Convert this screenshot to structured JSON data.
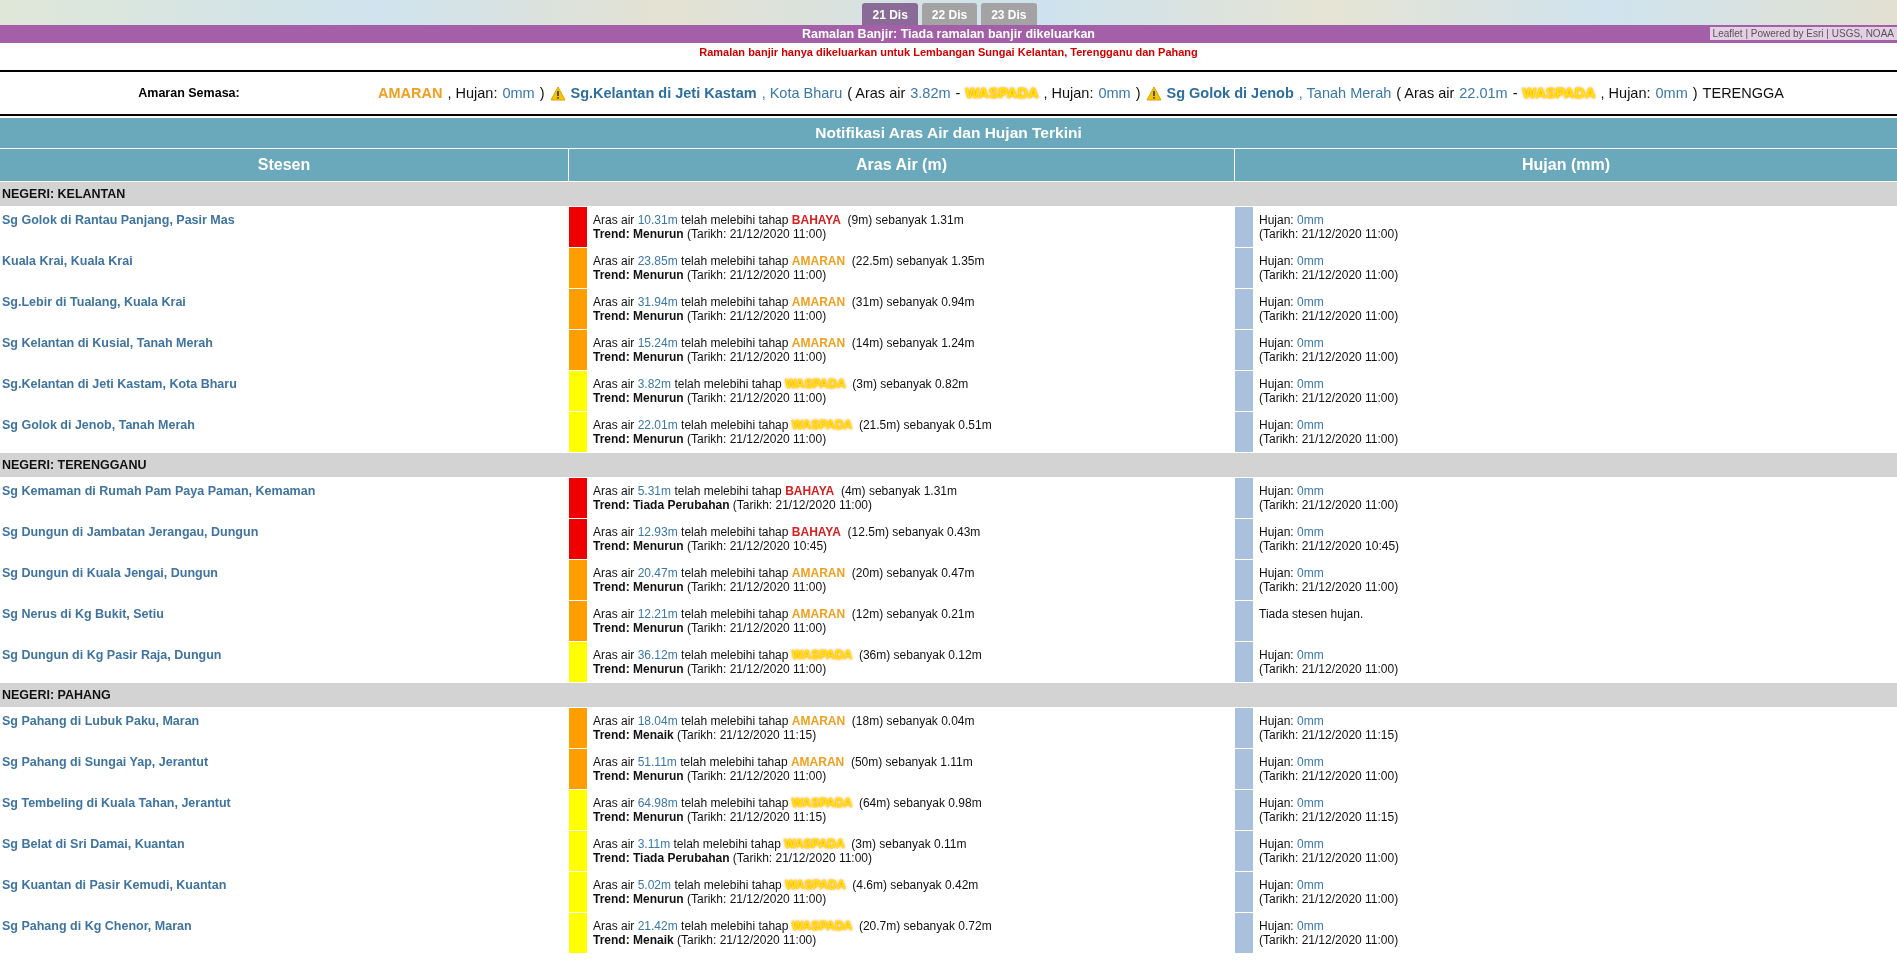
{
  "map": {
    "tabs": [
      {
        "label": "21 Dis",
        "selected": true
      },
      {
        "label": "22 Dis",
        "selected": false
      },
      {
        "label": "23 Dis",
        "selected": false
      }
    ],
    "attribution": "Leaflet | Powered by Esri | USGS, NOAA"
  },
  "forecast": {
    "title": "Ramalan Banjir: Tiada ramalan banjir dikeluarkan",
    "note": "Ramalan banjir hanya dikeluarkan untuk Lembangan Sungai Kelantan, Terengganu dan Pahang"
  },
  "current_alerts": {
    "label": "Amaran Semasa:",
    "ticker": [
      {
        "kind": "status",
        "text": "AMARAN",
        "color": "#f0a020"
      },
      {
        "kind": "plain",
        "text": ", Hujan:"
      },
      {
        "kind": "value",
        "text": "0mm"
      },
      {
        "kind": "plain",
        "text": ")"
      },
      {
        "kind": "icon"
      },
      {
        "kind": "station",
        "text": "Sg.Kelantan di Jeti Kastam"
      },
      {
        "kind": "place",
        "text": ", Kota Bharu"
      },
      {
        "kind": "plain",
        "text": "( Aras air"
      },
      {
        "kind": "value",
        "text": "3.82m"
      },
      {
        "kind": "plain",
        "text": "-"
      },
      {
        "kind": "status",
        "text": "WASPADA",
        "color": "#ffe600"
      },
      {
        "kind": "plain",
        "text": ", Hujan:"
      },
      {
        "kind": "value",
        "text": "0mm"
      },
      {
        "kind": "plain",
        "text": ")"
      },
      {
        "kind": "icon"
      },
      {
        "kind": "station",
        "text": "Sg Golok di Jenob"
      },
      {
        "kind": "place",
        "text": ", Tanah Merah"
      },
      {
        "kind": "plain",
        "text": "( Aras air"
      },
      {
        "kind": "value",
        "text": "22.01m"
      },
      {
        "kind": "plain",
        "text": "-"
      },
      {
        "kind": "status",
        "text": "WASPADA",
        "color": "#ffe600"
      },
      {
        "kind": "plain",
        "text": ", Hujan:"
      },
      {
        "kind": "value",
        "text": "0mm"
      },
      {
        "kind": "plain",
        "text": ")"
      },
      {
        "kind": "plain",
        "text": "TERENGGA"
      }
    ]
  },
  "table": {
    "title": "Notifikasi Aras Air dan Hujan Terkini",
    "columns": [
      "Stesen",
      "Aras Air (m)",
      "Hujan (mm)"
    ],
    "groups": [
      {
        "name": "NEGERI: KELANTAN",
        "rows": [
          {
            "station": "Sg Golok di Rantau Panjang, Pasir Mas",
            "water": {
              "color": "#ee0000",
              "prefix": "Aras air",
              "value": "10.31m",
              "middle": "telah melebihi tahap",
              "status": "BAHAYA",
              "detail": "(9m) sebanyak 1.31m",
              "trend": "**Trend: Menurun** (Tarikh: 21/12/2020 11:00)"
            },
            "rain": {
              "kind": "reading",
              "label": "Hujan:",
              "value": "0mm",
              "date": "(Tarikh: 21/12/2020 11:00)"
            }
          },
          {
            "station": "Kuala Krai, Kuala Krai",
            "water": {
              "color": "#ff9e00",
              "prefix": "Aras air",
              "value": "23.85m",
              "middle": "telah melebihi tahap",
              "status": "AMARAN",
              "detail": "(22.5m) sebanyak 1.35m",
              "trend": "**Trend: Menurun** (Tarikh: 21/12/2020 11:00)"
            },
            "rain": {
              "kind": "reading",
              "label": "Hujan:",
              "value": "0mm",
              "date": "(Tarikh: 21/12/2020 11:00)"
            }
          },
          {
            "station": "Sg.Lebir di Tualang, Kuala Krai",
            "water": {
              "color": "#ff9e00",
              "prefix": "Aras air",
              "value": "31.94m",
              "middle": "telah melebihi tahap",
              "status": "AMARAN",
              "detail": "(31m) sebanyak 0.94m",
              "trend": "**Trend: Menurun** (Tarikh: 21/12/2020 11:00)"
            },
            "rain": {
              "kind": "reading",
              "label": "Hujan:",
              "value": "0mm",
              "date": "(Tarikh: 21/12/2020 11:00)"
            }
          },
          {
            "station": "Sg Kelantan di Kusial, Tanah Merah",
            "water": {
              "color": "#ff9e00",
              "prefix": "Aras air",
              "value": "15.24m",
              "middle": "telah melebihi tahap",
              "status": "AMARAN",
              "detail": "(14m) sebanyak 1.24m",
              "trend": "**Trend: Menurun** (Tarikh: 21/12/2020 11:00)"
            },
            "rain": {
              "kind": "reading",
              "label": "Hujan:",
              "value": "0mm",
              "date": "(Tarikh: 21/12/2020 11:00)"
            }
          },
          {
            "station": "Sg.Kelantan di Jeti Kastam, Kota Bharu",
            "water": {
              "color": "#ffff00",
              "prefix": "Aras air",
              "value": "3.82m",
              "middle": "telah melebihi tahap",
              "status": "WASPADA",
              "detail": "(3m) sebanyak 0.82m",
              "trend": "**Trend: Menurun** (Tarikh: 21/12/2020 11:00)"
            },
            "rain": {
              "kind": "reading",
              "label": "Hujan:",
              "value": "0mm",
              "date": "(Tarikh: 21/12/2020 11:00)"
            }
          },
          {
            "station": "Sg Golok di Jenob, Tanah Merah",
            "water": {
              "color": "#ffff00",
              "prefix": "Aras air",
              "value": "22.01m",
              "middle": "telah melebihi tahap",
              "status": "WASPADA",
              "detail": "(21.5m) sebanyak 0.51m",
              "trend": "**Trend: Menurun** (Tarikh: 21/12/2020 11:00)"
            },
            "rain": {
              "kind": "reading",
              "label": "Hujan:",
              "value": "0mm",
              "date": "(Tarikh: 21/12/2020 11:00)"
            }
          }
        ]
      },
      {
        "name": "NEGERI: TERENGGANU",
        "rows": [
          {
            "station": "Sg Kemaman di Rumah Pam Paya Paman, Kemaman",
            "water": {
              "color": "#ee0000",
              "prefix": "Aras air",
              "value": "5.31m",
              "middle": "telah melebihi tahap",
              "status": "BAHAYA",
              "detail": "(4m) sebanyak 1.31m",
              "trend": "**Trend: Tiada Perubahan** (Tarikh: 21/12/2020 11:00)"
            },
            "rain": {
              "kind": "reading",
              "label": "Hujan:",
              "value": "0mm",
              "date": "(Tarikh: 21/12/2020 11:00)"
            }
          },
          {
            "station": "Sg Dungun di Jambatan Jerangau, Dungun",
            "water": {
              "color": "#ee0000",
              "prefix": "Aras air",
              "value": "12.93m",
              "middle": "telah melebihi tahap",
              "status": "BAHAYA",
              "detail": "(12.5m) sebanyak 0.43m",
              "trend": "**Trend: Menurun** (Tarikh: 21/12/2020 10:45)"
            },
            "rain": {
              "kind": "reading",
              "label": "Hujan:",
              "value": "0mm",
              "date": "(Tarikh: 21/12/2020 10:45)"
            }
          },
          {
            "station": "Sg Dungun di Kuala Jengai, Dungun",
            "water": {
              "color": "#ff9e00",
              "prefix": "Aras air",
              "value": "20.47m",
              "middle": "telah melebihi tahap",
              "status": "AMARAN",
              "detail": "(20m) sebanyak 0.47m",
              "trend": "**Trend: Menurun** (Tarikh: 21/12/2020 11:00)"
            },
            "rain": {
              "kind": "reading",
              "label": "Hujan:",
              "value": "0mm",
              "date": "(Tarikh: 21/12/2020 11:00)"
            }
          },
          {
            "station": "Sg Nerus di Kg Bukit, Setiu",
            "water": {
              "color": "#ff9e00",
              "prefix": "Aras air",
              "value": "12.21m",
              "middle": "telah melebihi tahap",
              "status": "AMARAN",
              "detail": "(12m) sebanyak 0.21m",
              "trend": "**Trend: Menurun** (Tarikh: 21/12/2020 11:00)"
            },
            "rain": {
              "kind": "none",
              "text": "Tiada stesen hujan."
            }
          },
          {
            "station": "Sg Dungun di Kg Pasir Raja, Dungun",
            "water": {
              "color": "#ffff00",
              "prefix": "Aras air",
              "value": "36.12m",
              "middle": "telah melebihi tahap",
              "status": "WASPADA",
              "detail": "(36m) sebanyak 0.12m",
              "trend": "**Trend: Menurun** (Tarikh: 21/12/2020 11:00)"
            },
            "rain": {
              "kind": "reading",
              "label": "Hujan:",
              "value": "0mm",
              "date": "(Tarikh: 21/12/2020 11:00)"
            }
          }
        ]
      },
      {
        "name": "NEGERI: PAHANG",
        "rows": [
          {
            "station": "Sg Pahang di Lubuk Paku, Maran",
            "water": {
              "color": "#ff9e00",
              "prefix": "Aras air",
              "value": "18.04m",
              "middle": "telah melebihi tahap",
              "status": "AMARAN",
              "detail": "(18m) sebanyak 0.04m",
              "trend": "**Trend: Menaik** (Tarikh: 21/12/2020 11:15)"
            },
            "rain": {
              "kind": "reading",
              "label": "Hujan:",
              "value": "0mm",
              "date": "(Tarikh: 21/12/2020 11:15)"
            }
          },
          {
            "station": "Sg Pahang di Sungai Yap, Jerantut",
            "water": {
              "color": "#ff9e00",
              "prefix": "Aras air",
              "value": "51.11m",
              "middle": "telah melebihi tahap",
              "status": "AMARAN",
              "detail": "(50m) sebanyak 1.11m",
              "trend": "**Trend: Menurun** (Tarikh: 21/12/2020 11:00)"
            },
            "rain": {
              "kind": "reading",
              "label": "Hujan:",
              "value": "0mm",
              "date": "(Tarikh: 21/12/2020 11:00)"
            }
          },
          {
            "station": "Sg Tembeling di Kuala Tahan, Jerantut",
            "water": {
              "color": "#ffff00",
              "prefix": "Aras air",
              "value": "64.98m",
              "middle": "telah melebihi tahap",
              "status": "WASPADA",
              "detail": "(64m) sebanyak 0.98m",
              "trend": "**Trend: Menurun** (Tarikh: 21/12/2020 11:15)"
            },
            "rain": {
              "kind": "reading",
              "label": "Hujan:",
              "value": "0mm",
              "date": "(Tarikh: 21/12/2020 11:15)"
            }
          },
          {
            "station": "Sg Belat di Sri Damai, Kuantan",
            "water": {
              "color": "#ffff00",
              "prefix": "Aras air",
              "value": "3.11m",
              "middle": "telah melebihi tahap",
              "status": "WASPADA",
              "detail": "(3m) sebanyak 0.11m",
              "trend": "**Trend: Tiada Perubahan** (Tarikh: 21/12/2020 11:00)"
            },
            "rain": {
              "kind": "reading",
              "label": "Hujan:",
              "value": "0mm",
              "date": "(Tarikh: 21/12/2020 11:00)"
            }
          },
          {
            "station": "Sg Kuantan di Pasir Kemudi, Kuantan",
            "water": {
              "color": "#ffff00",
              "prefix": "Aras air",
              "value": "5.02m",
              "middle": "telah melebihi tahap",
              "status": "WASPADA",
              "detail": "(4.6m) sebanyak 0.42m",
              "trend": "**Trend: Menurun** (Tarikh: 21/12/2020 11:00)"
            },
            "rain": {
              "kind": "reading",
              "label": "Hujan:",
              "value": "0mm",
              "date": "(Tarikh: 21/12/2020 11:00)"
            }
          },
          {
            "station": "Sg Pahang di Kg Chenor, Maran",
            "water": {
              "color": "#ffff00",
              "prefix": "Aras air",
              "value": "21.42m",
              "middle": "telah melebihi tahap",
              "status": "WASPADA",
              "detail": "(20.7m) sebanyak 0.72m",
              "trend": "**Trend: Menaik** (Tarikh: 21/12/2020 11:00)"
            },
            "rain": {
              "kind": "reading",
              "label": "Hujan:",
              "value": "0mm",
              "date": "(Tarikh: 21/12/2020 11:00)"
            }
          }
        ]
      }
    ]
  }
}
